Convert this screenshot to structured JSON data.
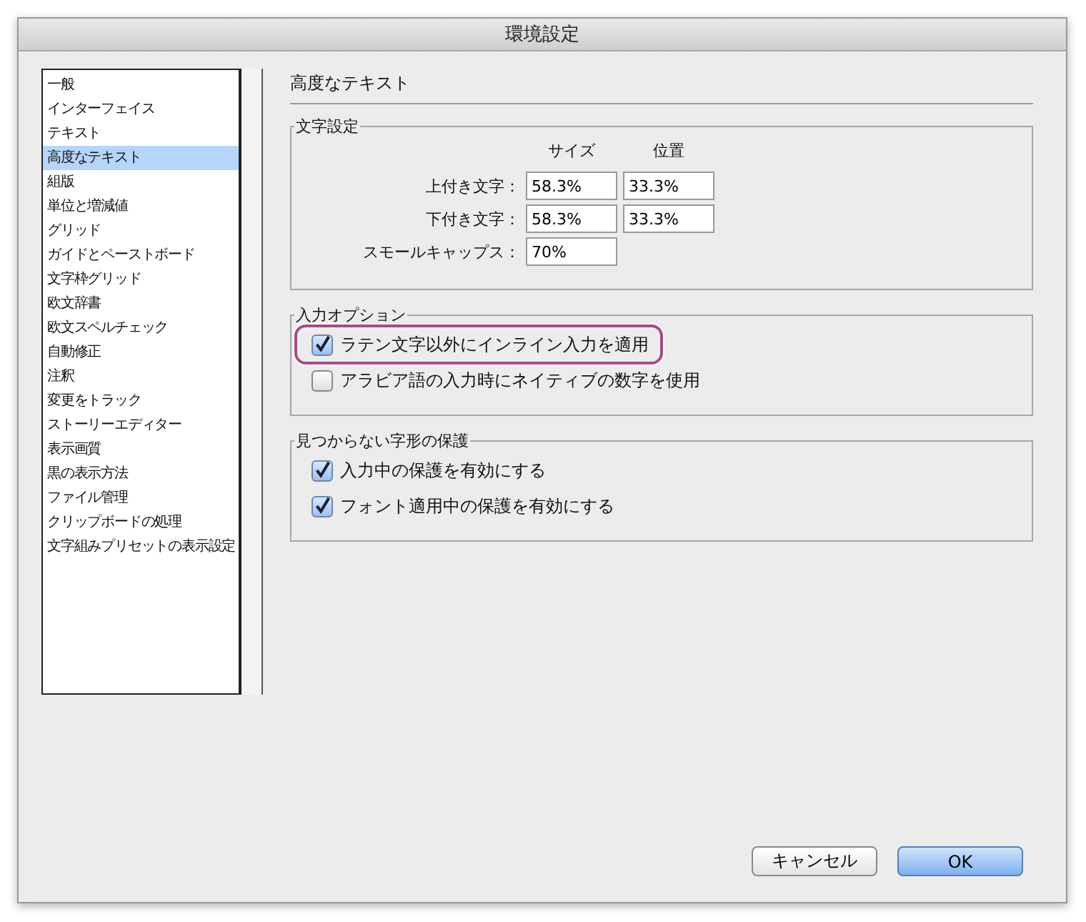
{
  "window": {
    "title": "環境設定"
  },
  "sidebar": {
    "items": [
      {
        "label": "一般",
        "selected": false
      },
      {
        "label": "インターフェイス",
        "selected": false
      },
      {
        "label": "テキスト",
        "selected": false
      },
      {
        "label": "高度なテキスト",
        "selected": true
      },
      {
        "label": "組版",
        "selected": false
      },
      {
        "label": "単位と増減値",
        "selected": false
      },
      {
        "label": "グリッド",
        "selected": false
      },
      {
        "label": "ガイドとペーストボード",
        "selected": false
      },
      {
        "label": "文字枠グリッド",
        "selected": false
      },
      {
        "label": "欧文辞書",
        "selected": false
      },
      {
        "label": "欧文スペルチェック",
        "selected": false
      },
      {
        "label": "自動修正",
        "selected": false
      },
      {
        "label": "注釈",
        "selected": false
      },
      {
        "label": "変更をトラック",
        "selected": false
      },
      {
        "label": "ストーリーエディター",
        "selected": false
      },
      {
        "label": "表示画質",
        "selected": false
      },
      {
        "label": "黒の表示方法",
        "selected": false
      },
      {
        "label": "ファイル管理",
        "selected": false
      },
      {
        "label": "クリップボードの処理",
        "selected": false
      },
      {
        "label": "文字組みプリセットの表示設定",
        "selected": false
      }
    ]
  },
  "panel_title": "高度なテキスト",
  "character_settings": {
    "title": "文字設定",
    "column_headers": [
      "サイズ",
      "位置"
    ],
    "rows": [
      {
        "label": "上付き文字：",
        "values": [
          "58.3%",
          "33.3%"
        ]
      },
      {
        "label": "下付き文字：",
        "values": [
          "58.3%",
          "33.3%"
        ]
      },
      {
        "label": "スモールキャップス：",
        "values": [
          "70%"
        ]
      }
    ]
  },
  "input_options": {
    "title": "入力オプション",
    "options": [
      {
        "label": "ラテン文字以外にインライン入力を適用",
        "checked": true,
        "highlighted": true
      },
      {
        "label": "アラビア語の入力時にネイティブの数字を使用",
        "checked": false,
        "highlighted": false
      }
    ]
  },
  "missing_glyph_protection": {
    "title": "見つからない字形の保護",
    "options": [
      {
        "label": "入力中の保護を有効にする",
        "checked": true,
        "highlighted": false
      },
      {
        "label": "フォント適用中の保護を有効にする",
        "checked": true,
        "highlighted": false
      }
    ]
  },
  "buttons": [
    {
      "label": "キャンセル",
      "kind": "secondary"
    },
    {
      "label": "OK",
      "kind": "primary"
    }
  ]
}
